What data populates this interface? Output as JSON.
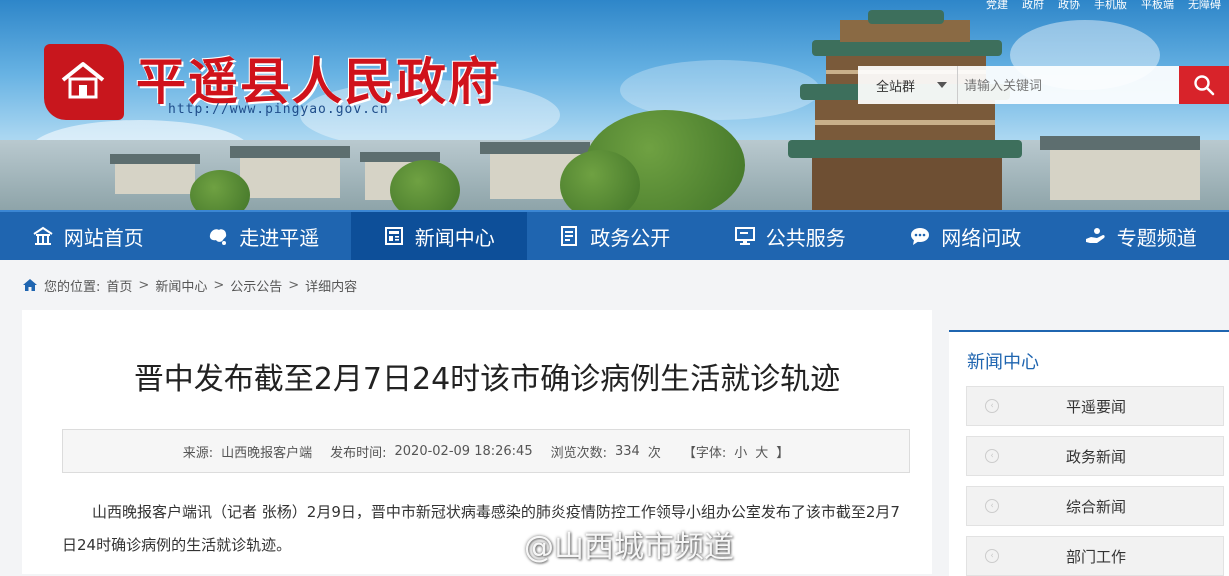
{
  "top_links": [
    "党建",
    "政府",
    "政协",
    "手机版",
    "平板端",
    "无障碍"
  ],
  "site": {
    "title": "平遥县人民政府",
    "url": "http://www.pingyao.gov.cn"
  },
  "search": {
    "scope": "全站群",
    "placeholder": "请输入关键词",
    "icon": "search-icon"
  },
  "nav": [
    {
      "label": "网站首页",
      "icon": "home-icon",
      "active": false
    },
    {
      "label": "走进平遥",
      "icon": "map-icon",
      "active": false
    },
    {
      "label": "新闻中心",
      "icon": "news-icon",
      "active": true
    },
    {
      "label": "政务公开",
      "icon": "document-icon",
      "active": false
    },
    {
      "label": "公共服务",
      "icon": "monitor-icon",
      "active": false
    },
    {
      "label": "网络问政",
      "icon": "chat-icon",
      "active": false
    },
    {
      "label": "专题频道",
      "icon": "hand-icon",
      "active": false
    }
  ],
  "breadcrumb": {
    "prefix": "您的位置:",
    "items": [
      "首页",
      "新闻中心",
      "公示公告",
      "详细内容"
    ]
  },
  "article": {
    "title": "晋中发布截至2月7日24时该市确诊病例生活就诊轨迹",
    "source_label": "来源:",
    "source": "山西晚报客户端",
    "time_label": "发布时间:",
    "time": "2020-02-09 18:26:45",
    "views_label": "浏览次数:",
    "views": "334",
    "views_unit": "次",
    "font_label": "【字体:",
    "font_small": "小",
    "font_large": "大",
    "font_end": "】",
    "paragraph": "山西晚报客户端讯（记者 张杨）2月9日，晋中市新冠状病毒感染的肺炎疫情防控工作领导小组办公室发布了该市截至2月7日24时确诊病例的生活就诊轨迹。"
  },
  "watermark": "@山西城市频道",
  "sidebar": {
    "title": "新闻中心",
    "links": [
      "平遥要闻",
      "政务新闻",
      "综合新闻",
      "部门工作"
    ]
  },
  "colors": {
    "nav_bg": "#1f65b0",
    "nav_active": "#0d4f99",
    "brand_red": "#d0121b",
    "search_btn": "#d8232a"
  }
}
